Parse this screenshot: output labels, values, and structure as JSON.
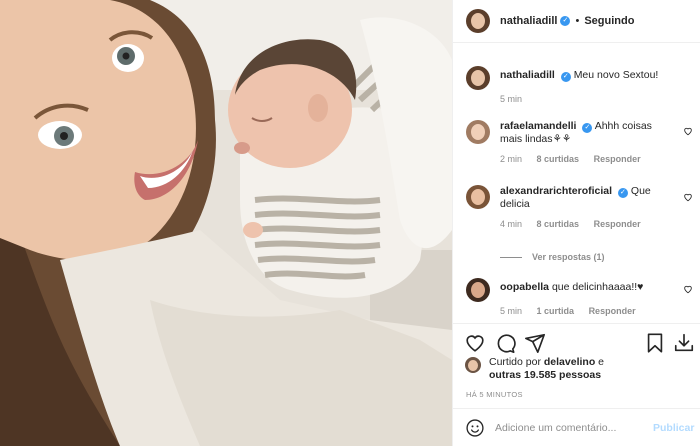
{
  "colors": {
    "link_blue": "#3897f0",
    "post_disabled": "#b3dbff",
    "secondary_text": "#8e8e8e",
    "border": "#efefef"
  },
  "photo": {
    "alt": "mother lying with newborn baby on her chest"
  },
  "header": {
    "username": "nathaliadill",
    "separator": "•",
    "follow_state": "Seguindo",
    "verified_icon": "verified-badge-icon"
  },
  "caption": {
    "username": "nathaliadill",
    "text": "Meu novo Sextou!",
    "time": "5 min"
  },
  "comments": [
    {
      "username": "rafaelamandelli",
      "text": "Ahhh coisas mais lindas⚘⚘",
      "time": "2 min",
      "likes": "8 curtidas",
      "reply": "Responder"
    },
    {
      "username": "alexandrarichteroficial",
      "text": "Que delicia",
      "time": "4 min",
      "likes": "8 curtidas",
      "reply": "Responder"
    },
    {
      "username": "oopabella",
      "text": "que delicinhaaaa!!♥",
      "time": "5 min",
      "likes": "1 curtida",
      "reply": "Responder"
    }
  ],
  "view_replies": "Ver respostas (1)",
  "actions": {
    "icons": [
      "heart-icon",
      "comment-icon",
      "share-icon",
      "bookmark-icon",
      "download-icon"
    ]
  },
  "liked_by": {
    "prefix": "Curtido por",
    "user": "delavelino",
    "middle": "e",
    "others": "outras 19.585 pessoas"
  },
  "timeago": "HÁ 5 MINUTOS",
  "add_comment": {
    "placeholder": "Adicione um comentário...",
    "post_label": "Publicar"
  }
}
